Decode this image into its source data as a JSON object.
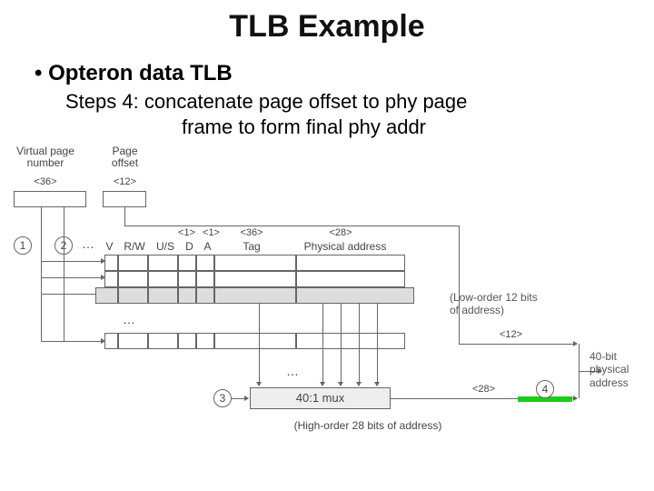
{
  "title": "TLB Example",
  "bullet": "Opteron data TLB",
  "steps_label": "Steps 4:",
  "steps_text": "concatenate page offset to phy page",
  "steps_sub": "frame to form final phy addr",
  "labels": {
    "vpn": "Virtual page\nnumber",
    "poff": "Page\noffset",
    "b36": "<36>",
    "b12": "<12>",
    "v": "V",
    "rw": "R/W",
    "us": "U/S",
    "d": "D",
    "a": "A",
    "tag": "Tag",
    "phys": "Physical address",
    "f1a": "<1>",
    "f1b": "<1>",
    "ftag": "<36>",
    "fpa": "<28>",
    "low": "(Low-order 12 bits\nof address)",
    "r12": "<12>",
    "mux": "40:1 mux",
    "r28": "<28>",
    "high": "(High-order 28 bits of address)",
    "out": "40-bit\nphysical\naddress"
  },
  "steps": {
    "s1": "1",
    "s2": "2",
    "s3": "3",
    "s4": "4"
  }
}
